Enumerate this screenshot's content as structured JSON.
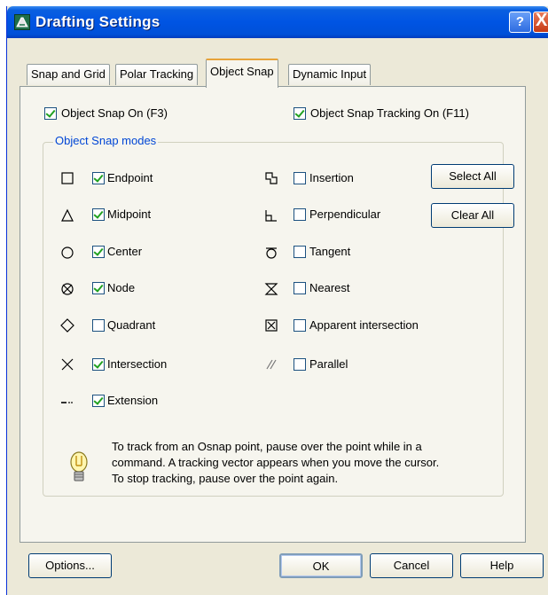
{
  "window": {
    "title": "Drafting Settings"
  },
  "titlebar": {
    "help_label": "?",
    "close_label": "X"
  },
  "tabs": [
    {
      "label": "Snap and Grid"
    },
    {
      "label": "Polar Tracking"
    },
    {
      "label": "Object Snap",
      "active": true
    },
    {
      "label": "Dynamic Input"
    }
  ],
  "object_snap_on": {
    "label": "Object Snap On (F3)",
    "checked": true
  },
  "object_snap_tracking_on": {
    "label": "Object Snap Tracking On (F11)",
    "checked": true
  },
  "modes_group": {
    "title": "Object Snap modes"
  },
  "left_modes": [
    {
      "label": "Endpoint",
      "checked": true,
      "icon": "endpoint-icon"
    },
    {
      "label": "Midpoint",
      "checked": true,
      "icon": "midpoint-icon"
    },
    {
      "label": "Center",
      "checked": true,
      "icon": "center-icon"
    },
    {
      "label": "Node",
      "checked": true,
      "icon": "node-icon"
    },
    {
      "label": "Quadrant",
      "checked": false,
      "icon": "quadrant-icon"
    },
    {
      "label": "Intersection",
      "checked": true,
      "icon": "intersection-icon"
    },
    {
      "label": "Extension",
      "checked": true,
      "icon": "extension-icon"
    }
  ],
  "right_modes": [
    {
      "label": "Insertion",
      "checked": false,
      "icon": "insertion-icon"
    },
    {
      "label": "Perpendicular",
      "checked": false,
      "icon": "perpendicular-icon"
    },
    {
      "label": "Tangent",
      "checked": false,
      "icon": "tangent-icon"
    },
    {
      "label": "Nearest",
      "checked": false,
      "icon": "nearest-icon"
    },
    {
      "label": "Apparent intersection",
      "checked": false,
      "icon": "apparent-intersection-icon"
    },
    {
      "label": "Parallel",
      "checked": false,
      "icon": "parallel-icon"
    }
  ],
  "buttons": {
    "select_all": "Select All",
    "clear_all": "Clear All",
    "options": "Options...",
    "ok": "OK",
    "cancel": "Cancel",
    "help": "Help"
  },
  "tip": {
    "icon": "lightbulb-icon",
    "line1": "To track from an Osnap point, pause over the point while in a",
    "line2": "command.  A tracking vector appears when you move the cursor.",
    "line3": "To stop tracking, pause over the point again."
  },
  "colors": {
    "titlebar": "#0054e3",
    "group_title": "#0046d5",
    "check": "#21a121",
    "active_tab_accent": "#e7a33a"
  }
}
